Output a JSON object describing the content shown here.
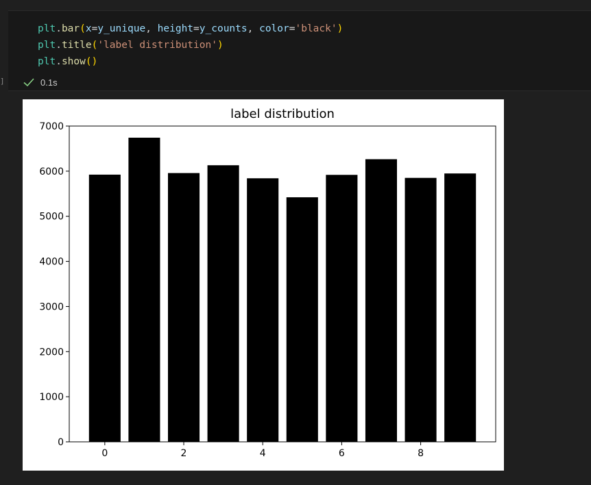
{
  "code_cell": {
    "line1": {
      "var": "plt",
      "dot": ".",
      "fn": "bar",
      "open": "(",
      "p1": "x",
      "eq1": "=",
      "v1": "y_unique",
      "comma1": ", ",
      "p2": "height",
      "eq2": "=",
      "v2": "y_counts",
      "comma2": ", ",
      "p3": "color",
      "eq3": "=",
      "s3": "'black'",
      "close": ")"
    },
    "line2": {
      "var": "plt",
      "dot": ".",
      "fn": "title",
      "open": "(",
      "s": "'label distribution'",
      "close": ")"
    },
    "line3": {
      "var": "plt",
      "dot": ".",
      "fn": "show",
      "parens": "()"
    },
    "bracket": "]",
    "status": {
      "icon": "check-icon",
      "time": "0.1s"
    }
  },
  "colors": {
    "bar": "#000000",
    "check": "#89d185"
  },
  "chart_data": {
    "type": "bar",
    "title": "label distribution",
    "xlabel": "",
    "ylabel": "",
    "categories": [
      0,
      1,
      2,
      3,
      4,
      5,
      6,
      7,
      8,
      9
    ],
    "values": [
      5923,
      6742,
      5958,
      6131,
      5842,
      5421,
      5918,
      6265,
      5851,
      5949
    ],
    "xlim": [
      -0.9,
      9.9
    ],
    "ylim": [
      0,
      7000
    ],
    "x_ticks": [
      0,
      2,
      4,
      6,
      8
    ],
    "y_ticks": [
      0,
      1000,
      2000,
      3000,
      4000,
      5000,
      6000,
      7000
    ],
    "grid": false
  }
}
